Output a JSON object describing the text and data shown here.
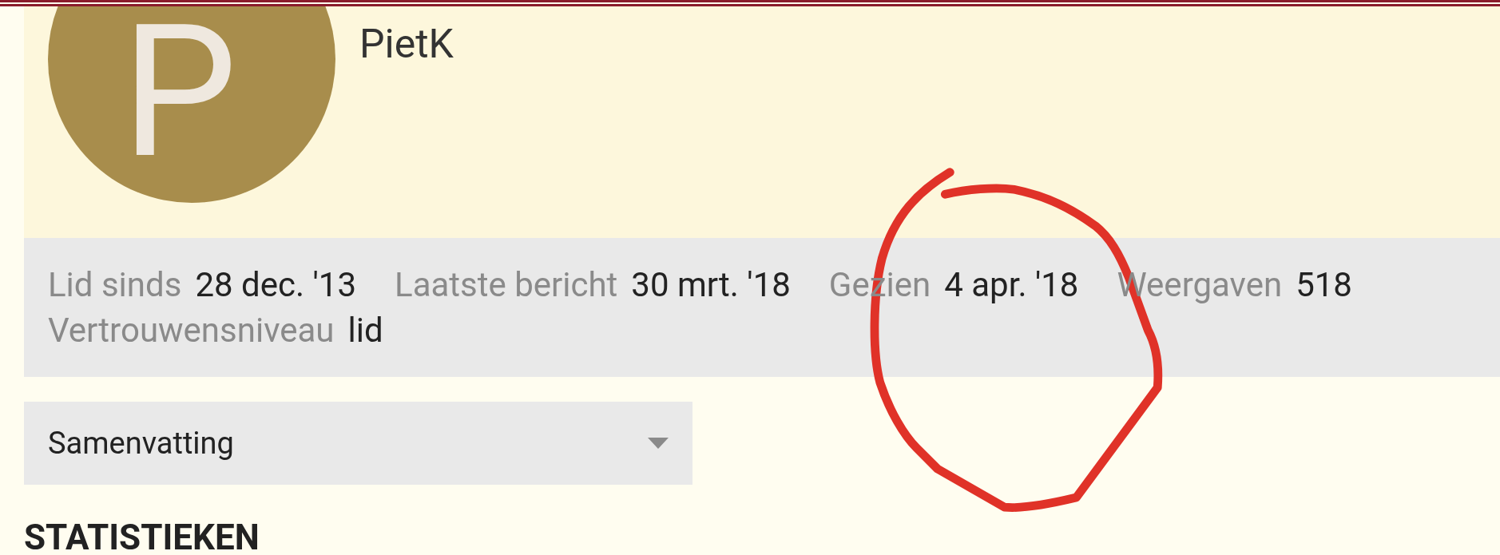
{
  "profile": {
    "avatar_letter": "P",
    "username": "PietK"
  },
  "stats": [
    {
      "label": "Lid sinds",
      "value": "28 dec. '13"
    },
    {
      "label": "Laatste bericht",
      "value": "30 mrt. '18"
    },
    {
      "label": "Gezien",
      "value": "4 apr. '18"
    },
    {
      "label": "Weergaven",
      "value": "518"
    },
    {
      "label": "Vertrouwensniveau",
      "value": "lid"
    }
  ],
  "section_select": {
    "value": "Samenvatting"
  },
  "section_heading": "STATISTIEKEN"
}
